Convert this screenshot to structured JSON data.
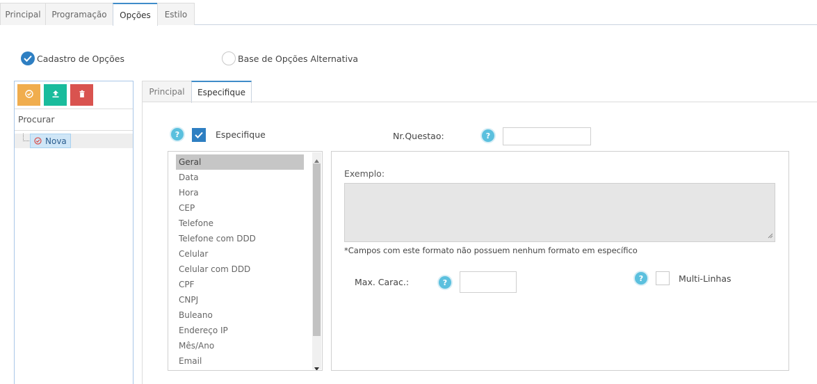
{
  "top_tabs": [
    "Principal",
    "Programação",
    "Opções",
    "Estilo"
  ],
  "mode": {
    "option1": "Cadastro de Opções",
    "option2": "Base de Opções Alternativa",
    "selected": "Cadastro de Opções"
  },
  "left": {
    "search_placeholder": "Procurar",
    "tree_node": "Nova",
    "toolbar_colors": {
      "confirm": "#f0ad4e",
      "upload": "#1abc9c",
      "delete": "#d9534f"
    }
  },
  "inner_tabs": [
    "Principal",
    "Especifique"
  ],
  "form": {
    "specify_label": "Especifique",
    "specify_checked": true,
    "question_label": "Nr.Questao:",
    "question_value": "",
    "formats": [
      "Geral",
      "Data",
      "Hora",
      "CEP",
      "Telefone",
      "Telefone com DDD",
      "Celular",
      "Celular com DDD",
      "CPF",
      "CNPJ",
      "Buleano",
      "Endereço IP",
      "Mês/Ano",
      "Email"
    ],
    "selected_format": "Geral",
    "example_label": "Exemplo:",
    "example_value": "",
    "note": "*Campos com este formato não possuem nenhum formato em específico",
    "max_chars_label": "Max. Carac.:",
    "max_chars_value": "",
    "multiline_label": "Multi-Linhas",
    "multiline_checked": false,
    "help_glyph": "?"
  },
  "colors": {
    "accent": "#2e7fc2",
    "help": "#5bc0de"
  }
}
